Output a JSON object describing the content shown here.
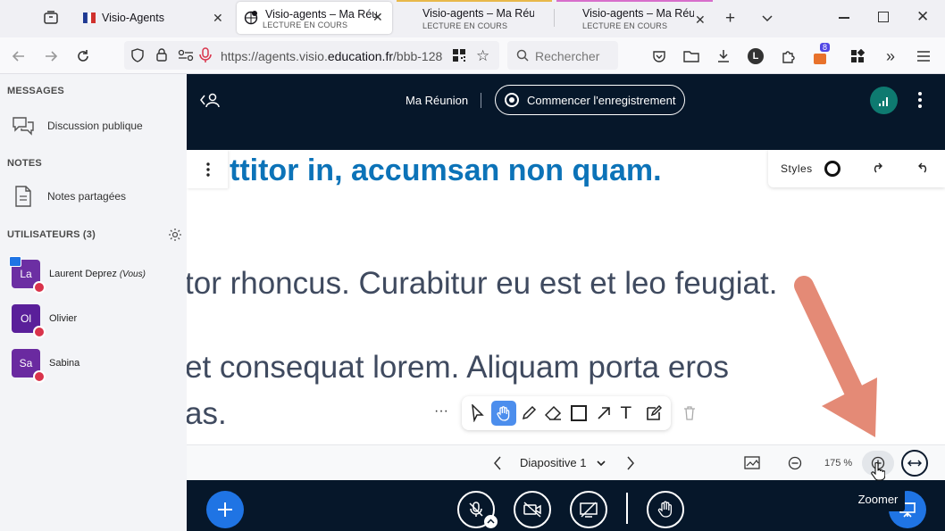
{
  "browser": {
    "tabs": [
      {
        "title": "Visio-Agents",
        "subtitle": ""
      },
      {
        "title": "Visio-agents – Ma Réunion",
        "subtitle": "LECTURE EN COURS"
      },
      {
        "title": "Visio-agents – Ma Réunion",
        "subtitle": "LECTURE EN COURS"
      },
      {
        "title": "Visio-agents – Ma Réunion",
        "subtitle": "LECTURE EN COURS"
      }
    ],
    "url_prefix": "https://agents.visio.",
    "url_domain": "education.fr",
    "url_suffix": "/bbb-128",
    "search_placeholder": "Rechercher",
    "account_initial": "L",
    "ext_badge": "8"
  },
  "sidebar": {
    "messages_title": "MESSAGES",
    "public_chat": "Discussion publique",
    "notes_title": "NOTES",
    "shared_notes": "Notes partagées",
    "users_title": "UTILISATEURS (3)",
    "users": [
      {
        "initials": "La",
        "name": "Laurent Deprez",
        "suffix": "(Vous)",
        "color": "#6c2fa3"
      },
      {
        "initials": "Ol",
        "name": "Olivier",
        "suffix": "",
        "color": "#5a1f9a"
      },
      {
        "initials": "Sa",
        "name": "Sabina",
        "suffix": "",
        "color": "#6a2aa0"
      }
    ]
  },
  "header": {
    "meeting_title": "Ma Réunion",
    "record_label": "Commencer l'enregistrement"
  },
  "slide": {
    "line1": "ttitor in, accumsan non quam.",
    "line2": "tor rhoncus. Curabitur eu est et leo feugiat.",
    "line3": "et consequat lorem. Aliquam porta eros",
    "line4": "as."
  },
  "whiteboard": {
    "styles_label": "Styles",
    "tools": [
      "select",
      "pan",
      "pencil",
      "eraser",
      "rectangle",
      "arrow",
      "text",
      "note"
    ]
  },
  "slide_nav": {
    "current_slide": "Diapositive 1",
    "zoom_level": "175 %",
    "tooltip": "Zoomer"
  },
  "colors": {
    "header_bg": "#06172a",
    "accent_blue": "#0c73b8",
    "slide_text": "#3f4a5f",
    "action_blue": "#1f74e4",
    "annotation_arrow": "#e48a76"
  }
}
